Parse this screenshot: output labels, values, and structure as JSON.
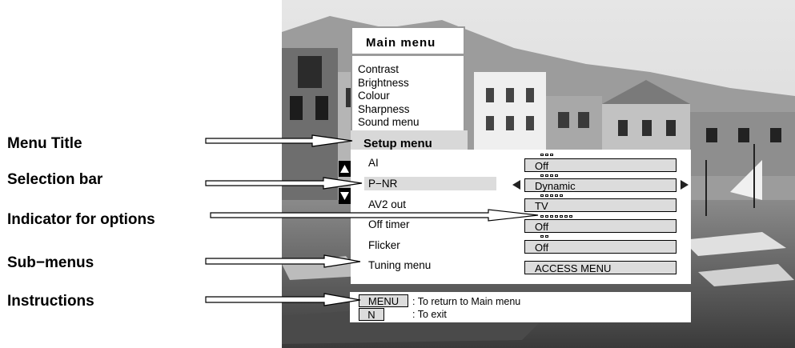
{
  "labels": {
    "menu_title": "Menu Title",
    "selection_bar": "Selection bar",
    "indicator": "Indicator for options",
    "sub_menus": "Sub−menus",
    "instructions": "Instructions"
  },
  "main_menu": {
    "title": "Main menu",
    "items": [
      "Contrast",
      "Brightness",
      "Colour",
      "Sharpness",
      "Sound menu"
    ]
  },
  "setup_menu": {
    "title": "Setup menu",
    "rows": [
      {
        "label": "AI",
        "value": "Off",
        "indicator_count": 3
      },
      {
        "label": "P−NR",
        "value": "Dynamic",
        "indicator_count": 4,
        "selected": true
      },
      {
        "label": "AV2 out",
        "value": "TV",
        "indicator_count": 5
      },
      {
        "label": "Off timer",
        "value": "Off",
        "indicator_count": 7
      },
      {
        "label": "Flicker",
        "value": "Off",
        "indicator_count": 2
      },
      {
        "label": "Tuning menu",
        "value": "ACCESS MENU",
        "indicator_count": 0
      }
    ]
  },
  "instructions": {
    "menu_key": "MENU",
    "menu_text": ": To return to Main menu",
    "n_key": "N",
    "n_text": ": To exit"
  }
}
